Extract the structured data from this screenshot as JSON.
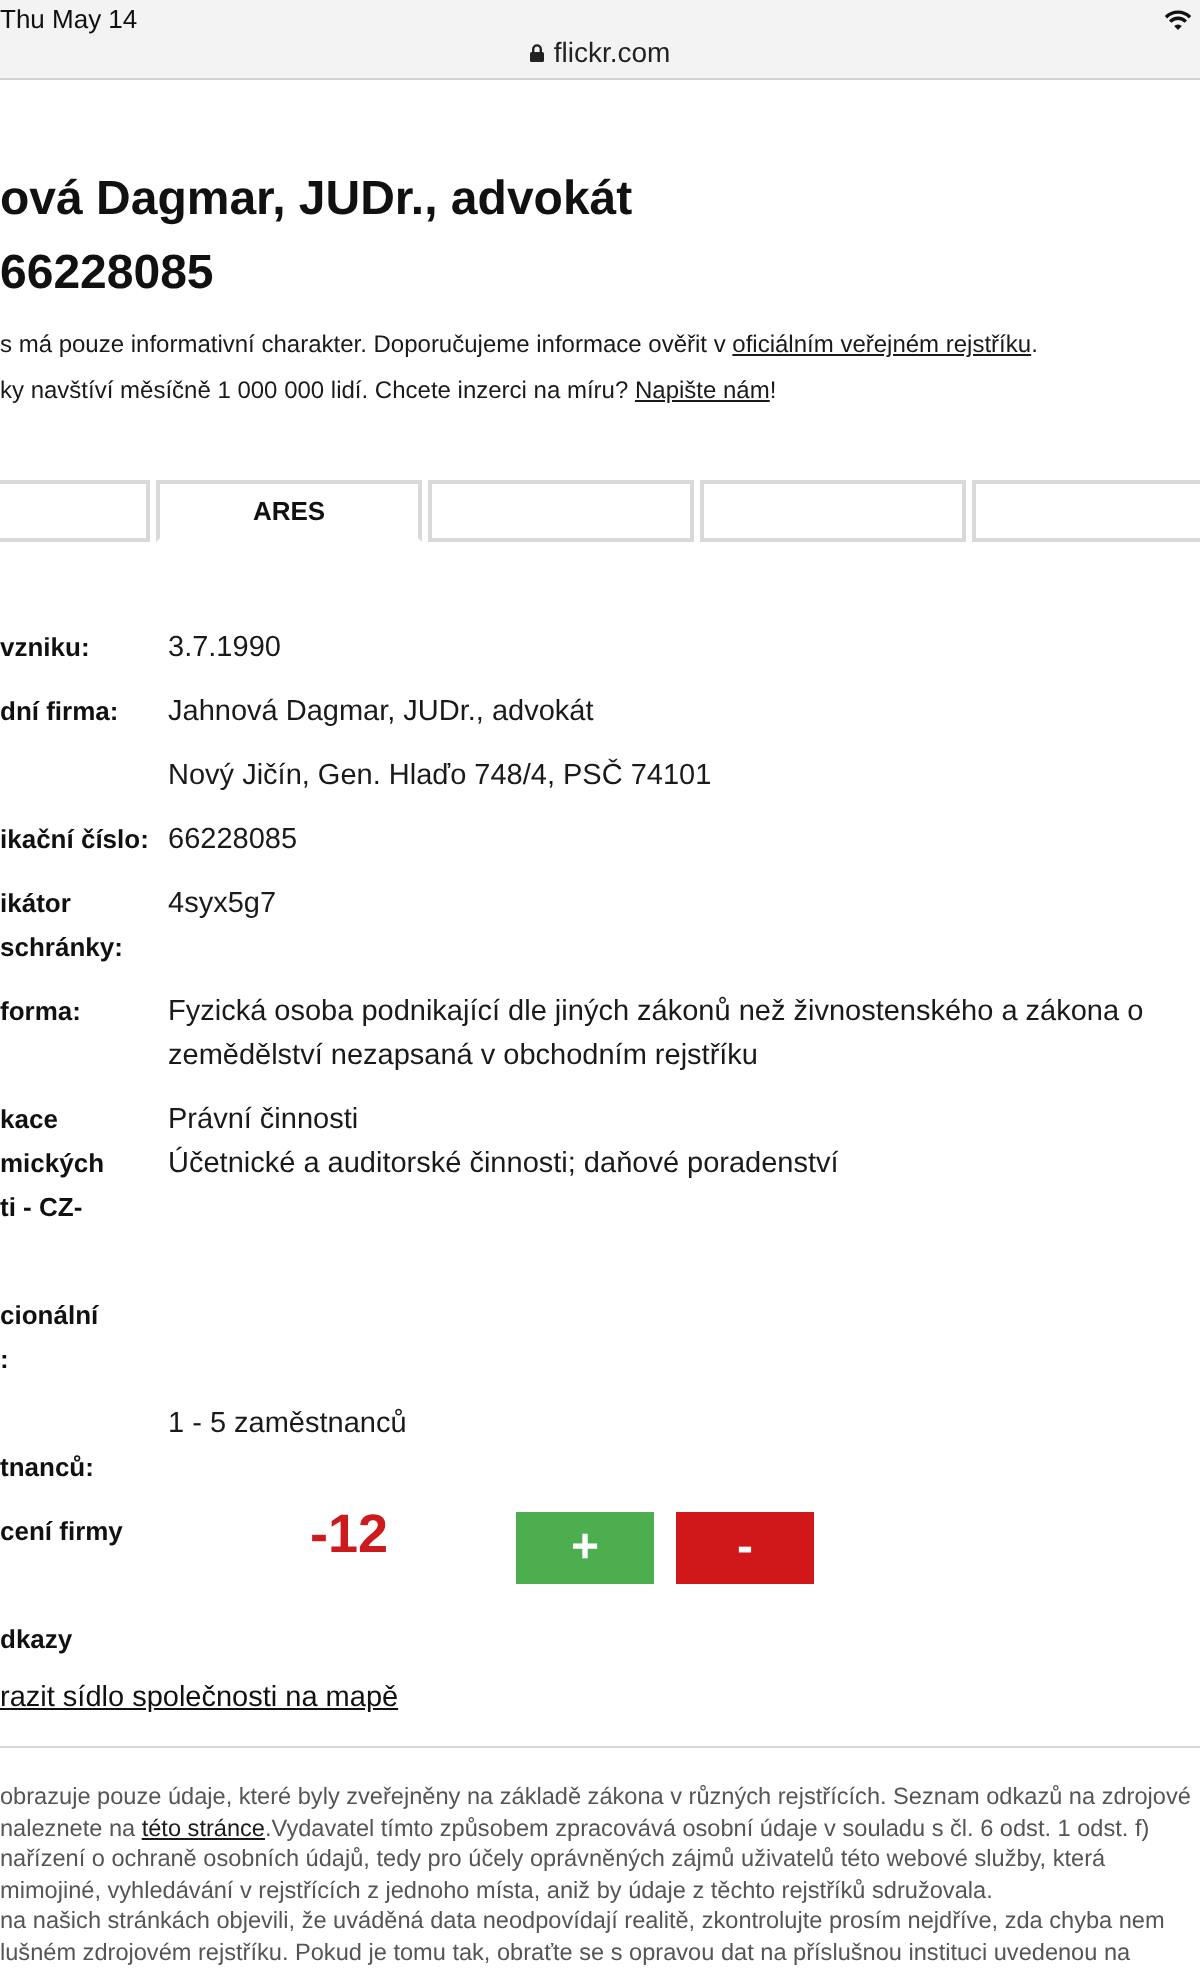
{
  "status_bar": {
    "time": "Thu May 14",
    "url": "flickr.com"
  },
  "title_lines": [
    "ová Dagmar, JUDr., advokát",
    "66228085"
  ],
  "notices": [
    {
      "text": "s má pouze informativní charakter. Doporučujeme informace ověřit v ",
      "link": "oficiálním veřejném rejstříku",
      "after": "."
    },
    {
      "text": "ky navštíví měsíčně 1 000 000 lidí. Chcete inzerci na míru? ",
      "link": "Napište nám",
      "after": "!"
    }
  ],
  "tabs": [
    {
      "selected": false
    },
    {
      "label": "ARES",
      "selected": true
    },
    {
      "selected": false
    },
    {
      "selected": false
    },
    {
      "selected": false
    }
  ],
  "fields": [
    {
      "kind": "text",
      "label": [
        "vzniku:"
      ],
      "values": [
        "3.7.1990"
      ]
    },
    {
      "kind": "text",
      "label": [
        "dní firma:"
      ],
      "values": [
        "Jahnová Dagmar, JUDr., advokát"
      ]
    },
    {
      "kind": "text",
      "values": [
        "Nový Jičín, Gen. Hlaďo 748/4, PSČ 74101"
      ]
    },
    {
      "kind": "text",
      "label": [
        "ikační číslo:"
      ],
      "values": [
        "66228085"
      ]
    },
    {
      "kind": "text",
      "label": [
        "ikátor",
        "schránky:"
      ],
      "values": [
        "4syx5g7"
      ]
    },
    {
      "kind": "text",
      "label": [
        "forma:"
      ],
      "values": [
        "Fyzická osoba podnikající dle jiných zákonů než živnostenského a zákona o zemědělství nezapsaná v obchodním rejstříku"
      ]
    },
    {
      "kind": "text",
      "label": [
        "kace",
        "mických",
        "ti - CZ-"
      ],
      "values": [
        "Právní činnosti",
        "Účetnické a auditorské činnosti; daňové poradenství"
      ]
    },
    {
      "kind": "text",
      "label": [
        "cionální",
        ":"
      ]
    },
    {
      "kind": "text",
      "label": [
        "tnanců:"
      ],
      "values": [
        "1 - 5 zaměstnanců"
      ]
    },
    {
      "kind": "rating",
      "label": [
        "cení firmy"
      ],
      "score": "-12",
      "buttons": [
        {
          "kind": "up",
          "label": "+"
        },
        {
          "kind": "down",
          "label": "-"
        }
      ]
    },
    {
      "kind": "links",
      "label": [
        "dkazy"
      ],
      "links": [
        "razit sídlo společnosti na mapě"
      ]
    }
  ],
  "disclaimer_lines": [
    {
      "text": "obrazuje pouze údaje, které byly zveřejněny na základě zákona v různých rejstřících. Seznam odkazů na zdrojové"
    },
    {
      "text": "naleznete na ",
      "link": "této stránce",
      "after": ".Vydavatel tímto způsobem zpracovává osobní údaje v souladu s čl. 6 odst. 1 odst. f)"
    },
    {
      "text": "nařízení o ochraně osobních údajů, tedy pro účely oprávněných zájmů uživatelů této webové služby, která"
    },
    {
      "text": "mimojiné, vyhledávání v rejstřících z jednoho místa, aniž by údaje z těchto rejstříků sdružovala."
    },
    {
      "text": "na našich stránkách objevili, že uváděná data neodpovídají realitě, zkontrolujte prosím nejdříve, zda chyba nem"
    },
    {
      "text": "lušném zdrojovém rejstříku. Pokud je tomu tak, obraťte se s opravou dat na příslušnou instituci uvedenou na"
    }
  ]
}
